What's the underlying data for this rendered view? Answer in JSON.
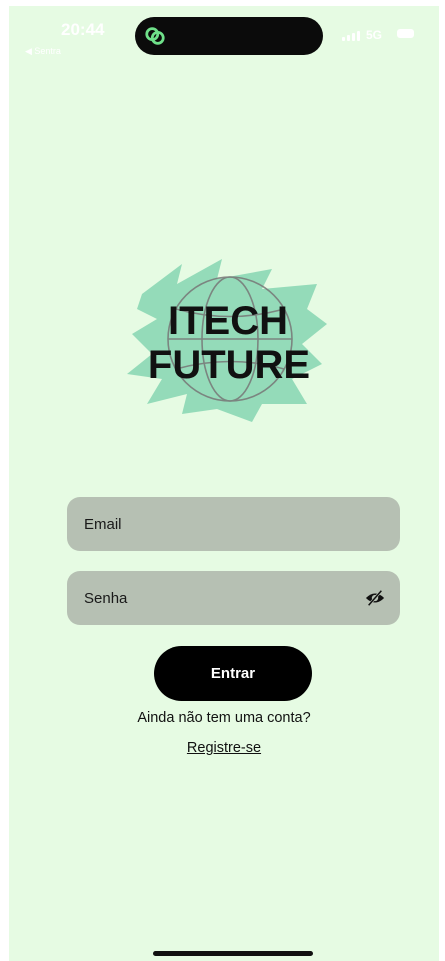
{
  "status_bar": {
    "time": "20:44",
    "back_app": "◀ Sentra",
    "network": "5G",
    "island_app_icon": "link-chain-icon"
  },
  "logo": {
    "line1": "ITECH",
    "line2": "FUTURE",
    "brush_color": "#8fd9b6"
  },
  "form": {
    "email_placeholder": "Email",
    "password_placeholder": "Senha",
    "password_toggle_icon": "eye-slash-icon",
    "submit_label": "Entrar",
    "no_account_text": "Ainda não tem uma conta?",
    "register_link": "Registre-se"
  },
  "colors": {
    "background": "#e6fbe3",
    "field": "#b6c0b3",
    "button": "#000000"
  }
}
